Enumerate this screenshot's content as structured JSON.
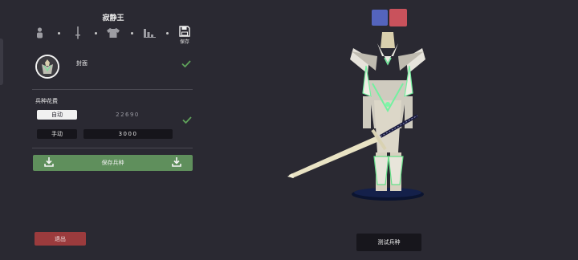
{
  "title": "寂静王",
  "toolbar": {
    "steps": [
      "person-icon",
      "sword-icon",
      "armor-icon",
      "stats-icon",
      "save-icon"
    ],
    "save_label": "保存"
  },
  "cover": {
    "label": "封面",
    "confirmed": true
  },
  "cost": {
    "label": "兵种花费",
    "auto_label": "自动",
    "auto_value": "22690",
    "manual_label": "手动",
    "manual_value": "3000",
    "confirmed": true
  },
  "save_unit_label": "保存兵种",
  "exit_label": "退出",
  "test_label": "测试兵种",
  "team_colors": [
    "#5464bd",
    "#c9525c"
  ],
  "accent": {
    "save": "#5f8f5c",
    "exit": "#9b3b3d",
    "check": "#5fa15a"
  }
}
